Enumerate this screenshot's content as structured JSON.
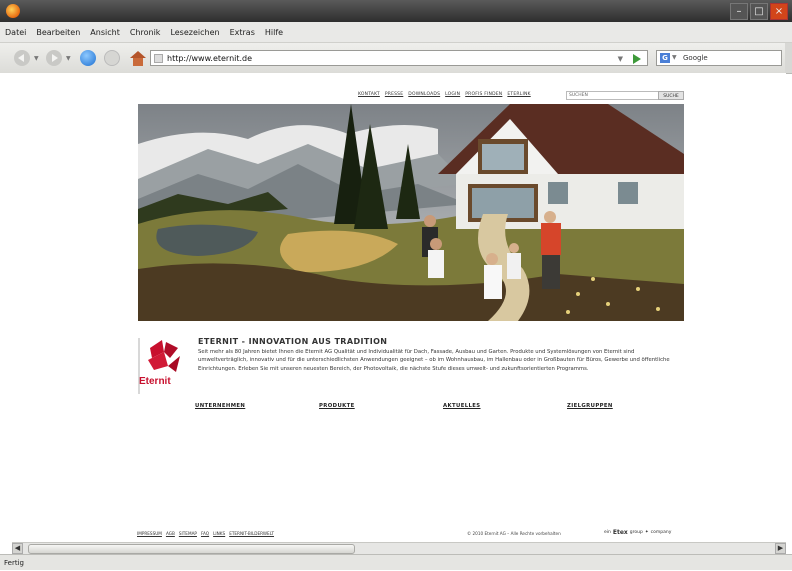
{
  "browser": {
    "menu": [
      "Datei",
      "Bearbeiten",
      "Ansicht",
      "Chronik",
      "Lesezeichen",
      "Extras",
      "Hilfe"
    ],
    "url": "http://www.eternit.de",
    "search_placeholder": "Google",
    "search_engine_icon": "G",
    "status": "Fertig"
  },
  "site": {
    "top_nav": [
      "KONTAKT",
      "PRESSE",
      "DOWNLOADS",
      "LOGIN",
      "PROFIS FINDEN",
      "ETERLINK"
    ],
    "search_placeholder": "SUCHEN",
    "search_button": "SUCHE",
    "logo_text": "Eternit",
    "headline": "ETERNIT - INNOVATION AUS TRADITION",
    "body": "Seit mehr als 80 Jahren bietet Ihnen die Eternit AG Qualität und Individualität für Dach, Fassade, Ausbau und Garten. Produkte und Systemlösungen von Eternit sind umweltverträglich, innovativ und für die unterschiedlichsten Anwendungen geeignet – ob im Wohnhausbau, im Hallenbau oder in Großbauten für Büros, Gewerbe und öffentliche Einrichtungen. Erleben Sie mit unseren neuesten Bereich, der Photovoltaik, die nächste Stufe dieses umwelt- und zukunftsorientierten Programms.",
    "categories": [
      "UNTERNEHMEN",
      "PRODUKTE",
      "AKTUELLES",
      "ZIELGRUPPEN"
    ],
    "footer_links": [
      "IMPRESSUM",
      "AGB",
      "SITEMAP",
      "FAQ",
      "LINKS",
      "ETERNIT-BILDERWELT"
    ],
    "copyright": "© 2010 Eternit AG – Alle Rechte vorbehalten",
    "group_prefix": "ein",
    "group_brand": "Etex",
    "group_suffix": "group",
    "group_company": "company"
  }
}
